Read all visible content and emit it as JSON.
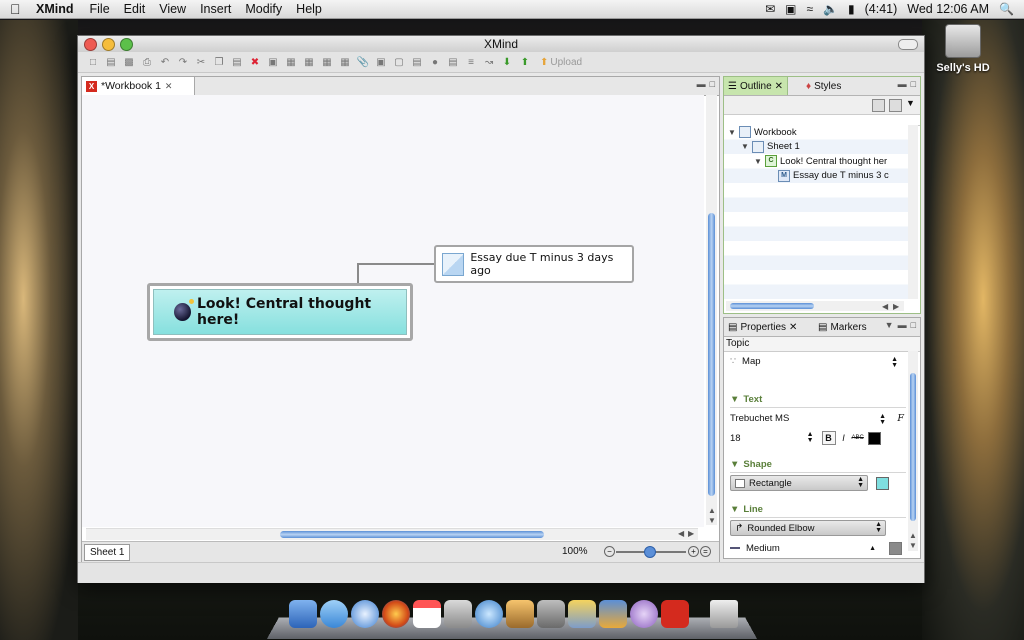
{
  "menubar": {
    "apple": "",
    "app": "XMind",
    "items": [
      "File",
      "Edit",
      "View",
      "Insert",
      "Modify",
      "Help"
    ],
    "battery": "(4:41)",
    "clock": "Wed 12:06 AM"
  },
  "desktop": {
    "hd_label": "Selly's HD"
  },
  "window": {
    "title": "XMind",
    "toolbar_upload": "Upload"
  },
  "editor": {
    "tab_title": "*Workbook 1",
    "sheet_tab": "Sheet 1",
    "zoom": "100%",
    "central_topic": "Look! Central thought here!",
    "subtopic": "Essay due T minus 3 days ago"
  },
  "outline": {
    "tabs": [
      "Outline",
      "Styles"
    ],
    "tree": [
      {
        "label": "Workbook",
        "icon": "W",
        "depth": 0
      },
      {
        "label": "Sheet 1",
        "icon": "S",
        "depth": 1
      },
      {
        "label": "Look! Central thought her",
        "icon": "C",
        "depth": 2
      },
      {
        "label": "Essay due T minus 3 c",
        "icon": "M",
        "depth": 3
      }
    ]
  },
  "properties": {
    "tabs": [
      "Properties",
      "Markers"
    ],
    "title": "Topic",
    "structure": "Map",
    "sections": {
      "text": "Text",
      "shape": "Shape",
      "line": "Line"
    },
    "font_name": "Trebuchet MS",
    "font_size": "18",
    "bold": "B",
    "italic": "I",
    "strike": "ABC",
    "font_button": "F",
    "shape_value": "Rectangle",
    "line_value": "Rounded Elbow",
    "line_width": "Medium",
    "colors": {
      "text": "#000000",
      "shape": "#7fdfe0",
      "line": "#8a8a8a"
    }
  }
}
